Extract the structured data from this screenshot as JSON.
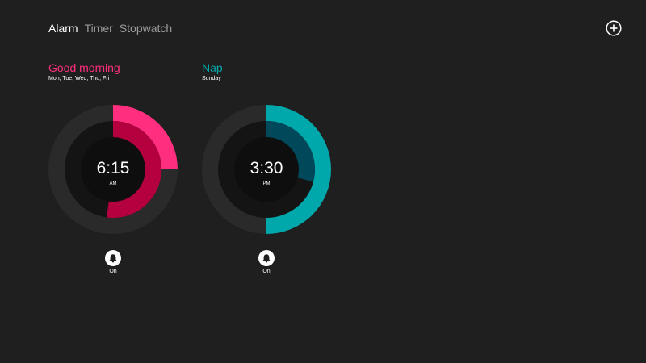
{
  "tabs": [
    {
      "label": "Alarm",
      "active": true
    },
    {
      "label": "Timer",
      "active": false
    },
    {
      "label": "Stopwatch",
      "active": false
    }
  ],
  "add_icon": "plus-circle-icon",
  "alarms": [
    {
      "name": "Good morning",
      "days": "Mon, Tue, Wed, Thu, Fri",
      "time": "6:15",
      "ampm": "AM",
      "hour": 6,
      "minute": 15,
      "accent": "#ff2e7e",
      "accent_dark": "#b5003f",
      "status_icon": "bell-icon",
      "status": "On"
    },
    {
      "name": "Nap",
      "days": "Sunday",
      "time": "3:30",
      "ampm": "PM",
      "hour": 3,
      "minute": 30,
      "accent": "#00a8ab",
      "accent_dark": "#00485a",
      "status_icon": "bell-icon",
      "status": "On"
    }
  ]
}
